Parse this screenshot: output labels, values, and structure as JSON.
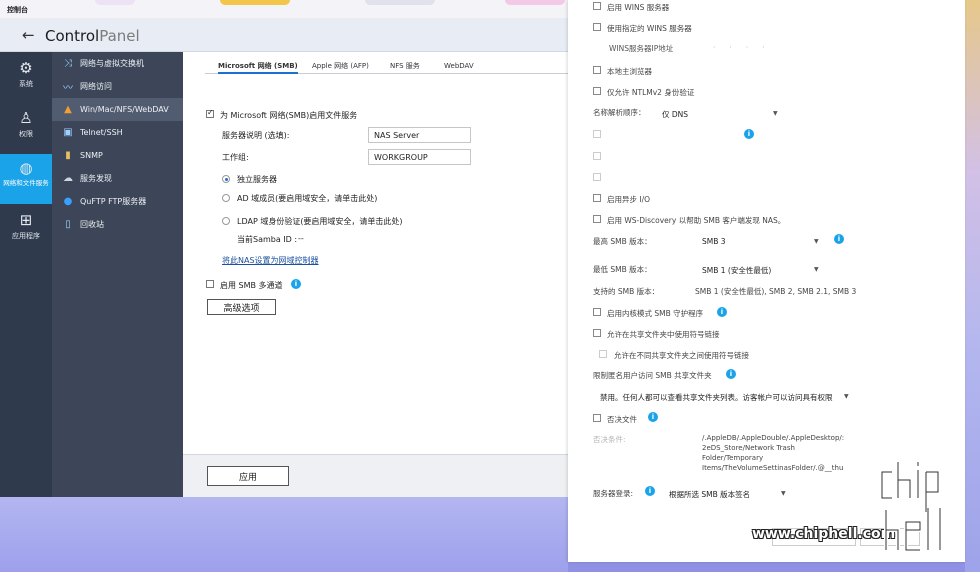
{
  "desktop": {
    "title": "控制台",
    "colors": {
      "accent": "#1aa3e8",
      "nav_dark": "#2f3a4c",
      "subnav": "#3c4658"
    }
  },
  "control_panel": {
    "title_bold": "Control",
    "title_light": "Panel",
    "left_nav": [
      {
        "icon": "gear-icon",
        "label": "系统"
      },
      {
        "icon": "user-icon",
        "label": "权限"
      },
      {
        "icon": "network-services-icon",
        "label": "网络和文件服务"
      },
      {
        "icon": "apps-icon",
        "label": "应用程序"
      }
    ],
    "sub_nav": [
      {
        "icon": "virtual-switch-icon",
        "label": "网络与虚拟交换机"
      },
      {
        "icon": "network-access-icon",
        "label": "网络访问"
      },
      {
        "icon": "win-mac-nfs-icon",
        "label": "Win/Mac/NFS/WebDAV"
      },
      {
        "icon": "terminal-icon",
        "label": "Telnet/SSH"
      },
      {
        "icon": "snmp-icon",
        "label": "SNMP"
      },
      {
        "icon": "service-discovery-icon",
        "label": "服务发现"
      },
      {
        "icon": "ftp-icon",
        "label": "QuFTP FTP服务器"
      },
      {
        "icon": "recycle-bin-icon",
        "label": "回收站"
      }
    ],
    "tabs": [
      "Microsoft 网络 (SMB)",
      "Apple 网络 (AFP)",
      "NFS 服务",
      "WebDAV"
    ],
    "enable_smb_label": "为 Microsoft 网络(SMB)启用文件服务",
    "server_desc_label": "服务器说明 (选填):",
    "server_desc_value": "NAS Server",
    "workgroup_label": "工作组:",
    "workgroup_value": "WORKGROUP",
    "radio_standalone": "独立服务器",
    "radio_ad": "AD 域成员(要启用域安全，请单击此处)",
    "radio_ldap": "LDAP 域身份验证(要启用域安全，请单击此处)",
    "samba_id_label": "当前Samba ID :",
    "samba_id_value": "--",
    "domain_controller_link": "将此NAS设置为网域控制器",
    "multichannel_label": "启用 SMB 多通道",
    "advanced_button": "高级选项",
    "apply_button": "应用"
  },
  "advanced": {
    "wins_server": "启用 WINS 服务器",
    "use_wins": "使用指定的 WINS 服务器",
    "wins_ip_label": "WINS服务器IP地址",
    "local_master": "本地主浏览器",
    "ntlmv2": "仅允许 NTLMv2 身份验证",
    "name_resolution_label": "名称解析顺序：",
    "name_resolution_value": "仅 DNS",
    "async_io": "启用异步 I/O",
    "ws_discovery": "启用 WS-Discovery 以帮助 SMB 客户端发现 NAS。",
    "max_smb_label": "最高 SMB 版本：",
    "max_smb_value": "SMB 3",
    "min_smb_label": "最低 SMB 版本：",
    "min_smb_value": "SMB 1 (安全性最低)",
    "supported_label": "支持的 SMB 版本：",
    "supported_value": "SMB 1 (安全性最低), SMB 2, SMB 2.1, SMB 3",
    "kernel_mode": "启用内核模式 SMB 守护程序",
    "allow_symlinks": "允许在共享文件夹中使用符号链接",
    "allow_cross_symlinks": "允许在不同共享文件夹之间使用符号链接",
    "restrict_anon_label": "限制匿名用户访问 SMB 共享文件夹",
    "restrict_anon_value": "禁用。任何人都可以查看共享文件夹列表。访客帐户可以访问具有权限",
    "veto_files": "否决文件",
    "veto_pattern_label": "否决条件:",
    "veto_pattern_lines": [
      "/.AppleDB/.AppleDouble/.AppleDesktop/:",
      "2eDS_Store/Network Trash",
      "Folder/Temporary",
      "Items/TheVolumeSettinasFolder/.@__thu"
    ],
    "server_signing_label": "服务器登录:",
    "server_signing_value": "根据所选 SMB 版本签名"
  },
  "watermark": "www.chiphell.com",
  "logo_text": "chip hell"
}
